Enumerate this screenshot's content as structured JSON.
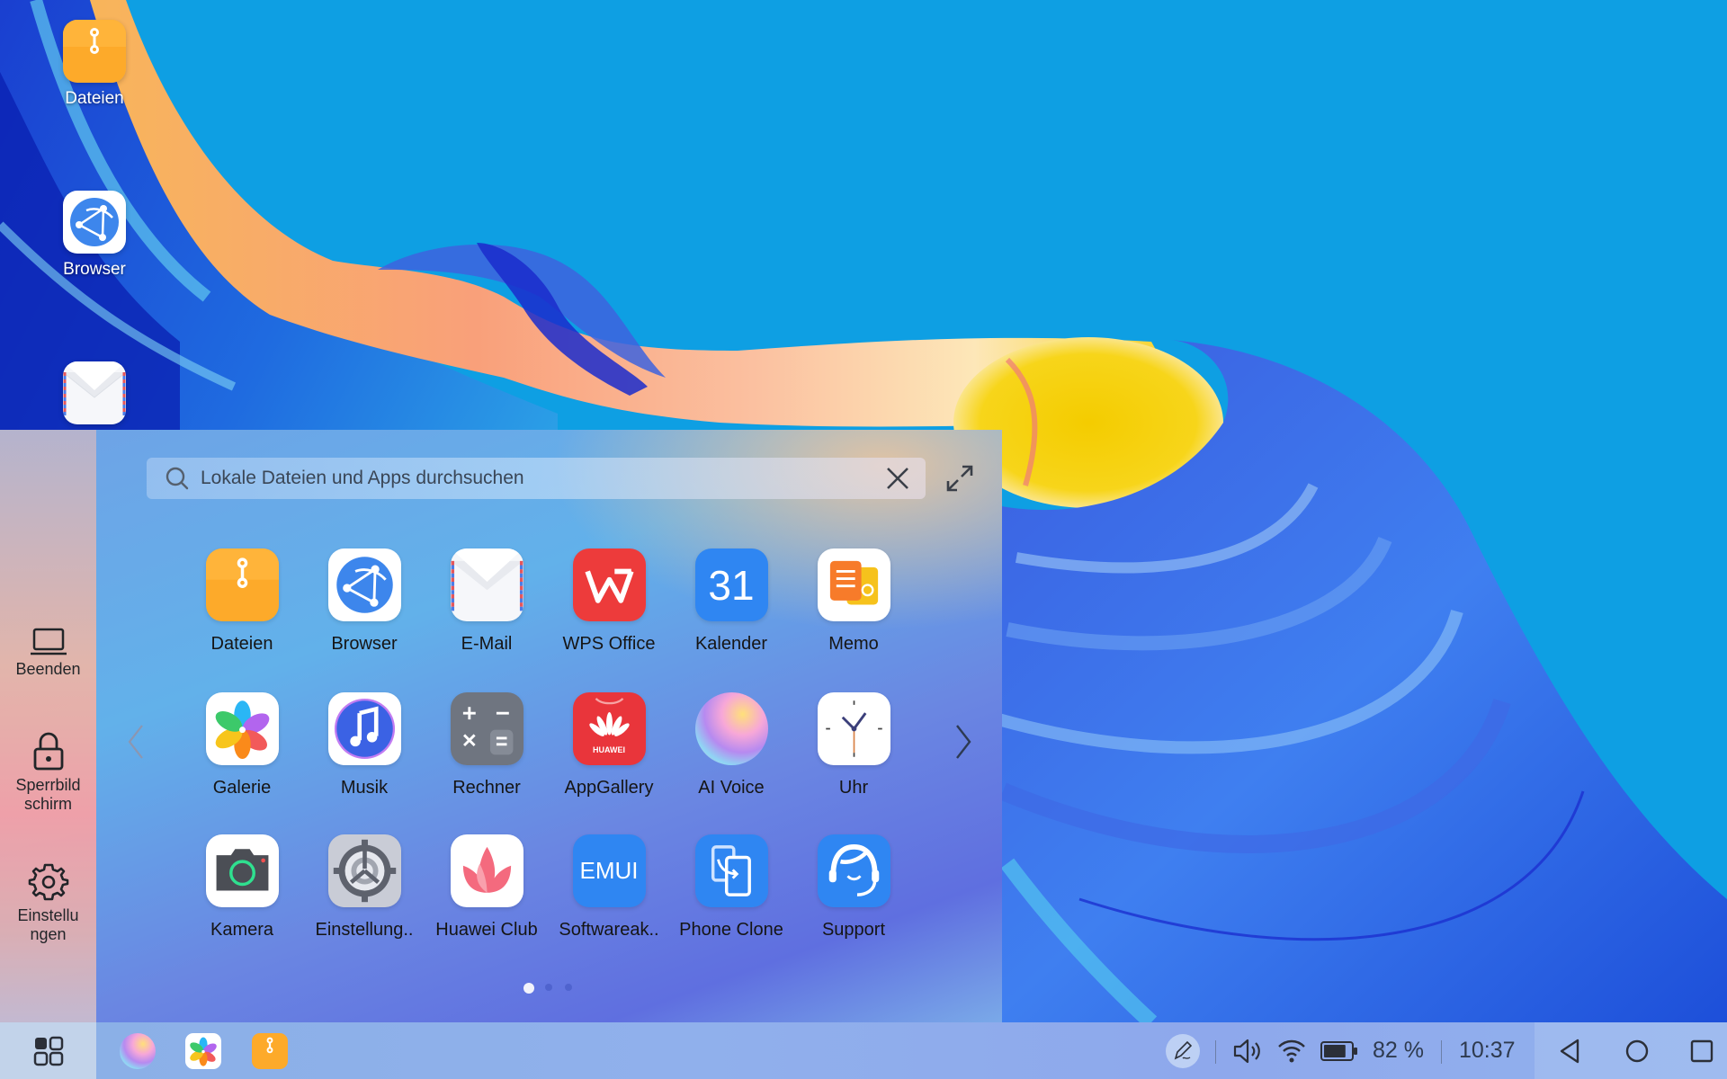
{
  "desktop": {
    "icons": [
      {
        "label": "Dateien",
        "icon": "files-icon"
      },
      {
        "label": "Browser",
        "icon": "browser-icon"
      },
      {
        "label": "",
        "icon": "email-icon"
      }
    ],
    "background_color": "#0e9fe3"
  },
  "start_panel": {
    "sidebar": {
      "items": [
        {
          "label": "Beenden",
          "icon": "laptop-icon"
        },
        {
          "label": "Sperrbild\nschirm",
          "icon": "lock-icon"
        },
        {
          "label": "Einstellu\nngen",
          "icon": "gear-icon"
        }
      ]
    },
    "search": {
      "placeholder": "Lokale Dateien und Apps durchsuchen",
      "value": ""
    },
    "apps": [
      {
        "label": "Dateien",
        "icon": "files-icon"
      },
      {
        "label": "Browser",
        "icon": "browser-icon"
      },
      {
        "label": "E-Mail",
        "icon": "email-icon"
      },
      {
        "label": "WPS Office",
        "icon": "wps-office-icon"
      },
      {
        "label": "Kalender",
        "icon": "calendar-icon",
        "badge": "31"
      },
      {
        "label": "Memo",
        "icon": "memo-icon"
      },
      {
        "label": "Galerie",
        "icon": "gallery-icon"
      },
      {
        "label": "Musik",
        "icon": "music-icon"
      },
      {
        "label": "Rechner",
        "icon": "calculator-icon"
      },
      {
        "label": "AppGallery",
        "icon": "appgallery-icon",
        "badge": "HUAWEI"
      },
      {
        "label": "AI Voice",
        "icon": "ai-voice-icon"
      },
      {
        "label": "Uhr",
        "icon": "clock-icon"
      },
      {
        "label": "Kamera",
        "icon": "camera-icon"
      },
      {
        "label": "Einstellung..",
        "icon": "settings-icon"
      },
      {
        "label": "Huawei Club",
        "icon": "huawei-club-icon"
      },
      {
        "label": "Softwareak..",
        "icon": "software-update-icon",
        "badge": "EMUI"
      },
      {
        "label": "Phone Clone",
        "icon": "phone-clone-icon"
      },
      {
        "label": "Support",
        "icon": "support-icon"
      }
    ],
    "pagination": {
      "pages": 3,
      "current": 1
    }
  },
  "taskbar": {
    "pinned": [
      {
        "name": "ai-voice"
      },
      {
        "name": "gallery"
      },
      {
        "name": "files"
      }
    ],
    "status": {
      "battery_percent": "82 %",
      "battery_level": 0.82,
      "time": "10:37"
    }
  }
}
